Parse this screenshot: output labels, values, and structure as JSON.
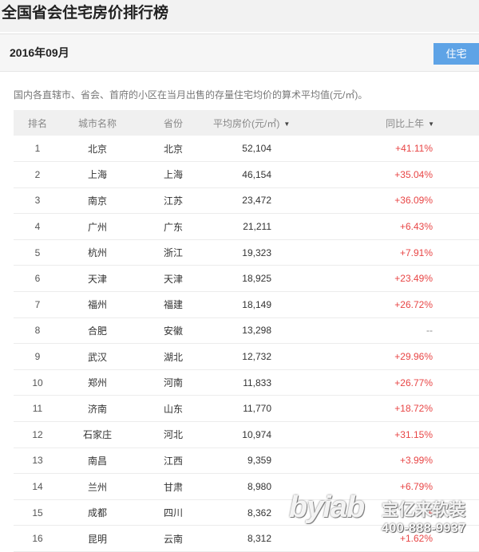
{
  "page_title": "全国省会住宅房价排行榜",
  "header": {
    "date": "2016年09月",
    "tab_label": "住宅"
  },
  "description": "国内各直辖市、省会、首府的小区在当月出售的存量住宅均价的算术平均值(元/㎡)。",
  "table": {
    "columns": [
      "排名",
      "城市名称",
      "省份",
      "平均房价(元/㎡)",
      "同比上年"
    ],
    "rows": [
      {
        "rank": "1",
        "city": "北京",
        "province": "北京",
        "price": "52,104",
        "change": "+41.11%"
      },
      {
        "rank": "2",
        "city": "上海",
        "province": "上海",
        "price": "46,154",
        "change": "+35.04%"
      },
      {
        "rank": "3",
        "city": "南京",
        "province": "江苏",
        "price": "23,472",
        "change": "+36.09%"
      },
      {
        "rank": "4",
        "city": "广州",
        "province": "广东",
        "price": "21,211",
        "change": "+6.43%"
      },
      {
        "rank": "5",
        "city": "杭州",
        "province": "浙江",
        "price": "19,323",
        "change": "+7.91%"
      },
      {
        "rank": "6",
        "city": "天津",
        "province": "天津",
        "price": "18,925",
        "change": "+23.49%"
      },
      {
        "rank": "7",
        "city": "福州",
        "province": "福建",
        "price": "18,149",
        "change": "+26.72%"
      },
      {
        "rank": "8",
        "city": "合肥",
        "province": "安徽",
        "price": "13,298",
        "change": "--"
      },
      {
        "rank": "9",
        "city": "武汉",
        "province": "湖北",
        "price": "12,732",
        "change": "+29.96%"
      },
      {
        "rank": "10",
        "city": "郑州",
        "province": "河南",
        "price": "11,833",
        "change": "+26.77%"
      },
      {
        "rank": "11",
        "city": "济南",
        "province": "山东",
        "price": "11,770",
        "change": "+18.72%"
      },
      {
        "rank": "12",
        "city": "石家庄",
        "province": "河北",
        "price": "10,974",
        "change": "+31.15%"
      },
      {
        "rank": "13",
        "city": "南昌",
        "province": "江西",
        "price": "9,359",
        "change": "+3.99%"
      },
      {
        "rank": "14",
        "city": "兰州",
        "province": "甘肃",
        "price": "8,980",
        "change": "+6.79%"
      },
      {
        "rank": "15",
        "city": "成都",
        "province": "四川",
        "price": "8,362",
        "change": "+"
      },
      {
        "rank": "16",
        "city": "昆明",
        "province": "云南",
        "price": "8,312",
        "change": "+1.62%"
      }
    ]
  },
  "watermark": {
    "brand": "byiab",
    "name": "宝亿来软装",
    "phone": "400-888-9937"
  },
  "colors": {
    "tab_active": "#5ea3e6",
    "positive": "#e84545",
    "header_bg": "#f0f0f0"
  }
}
